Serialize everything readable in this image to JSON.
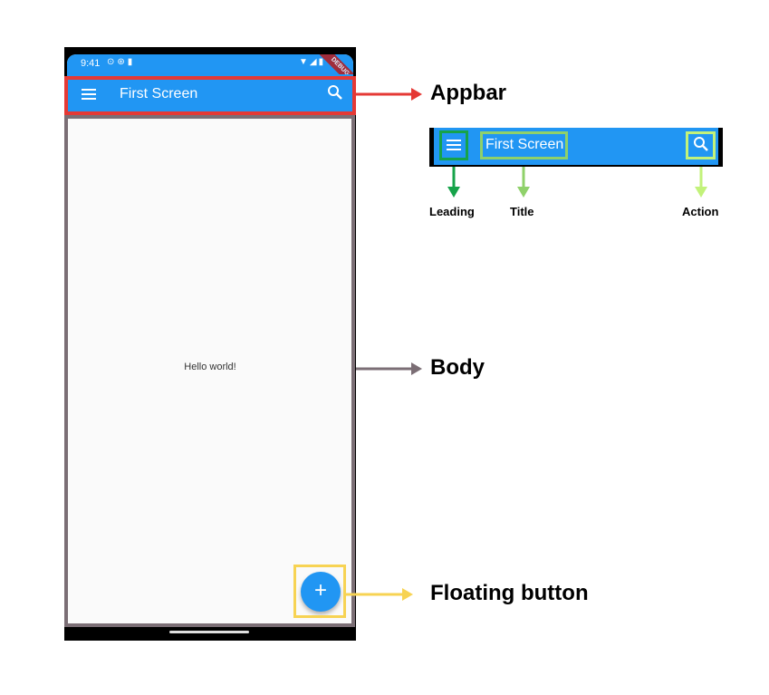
{
  "phone": {
    "status_time": "9:41",
    "status_icons_left": [
      "alarm-icon",
      "gamepad-icon",
      "sim-icon"
    ],
    "status_icons_right": [
      "wifi-icon",
      "signal-icon",
      "battery-icon"
    ],
    "debug_banner": "DEBUG",
    "appbar": {
      "title": "First Screen",
      "leading_icon": "menu-icon",
      "action_icon": "search-icon"
    },
    "body_text": "Hello world!",
    "fab_label": "+"
  },
  "callouts": {
    "appbar": "Appbar",
    "body": "Body",
    "floating_button": "Floating button"
  },
  "zoom": {
    "title": "First Screen",
    "labels": {
      "leading": "Leading",
      "title": "Title",
      "action": "Action"
    }
  },
  "colors": {
    "appbar_blue": "#2196f3",
    "appbar_highlight": "#e53935",
    "body_highlight": "#7b6e75",
    "fab_highlight": "#f7d353",
    "leading_highlight": "#16a34a",
    "title_highlight": "#8fd16a",
    "action_highlight": "#c2f27a"
  }
}
